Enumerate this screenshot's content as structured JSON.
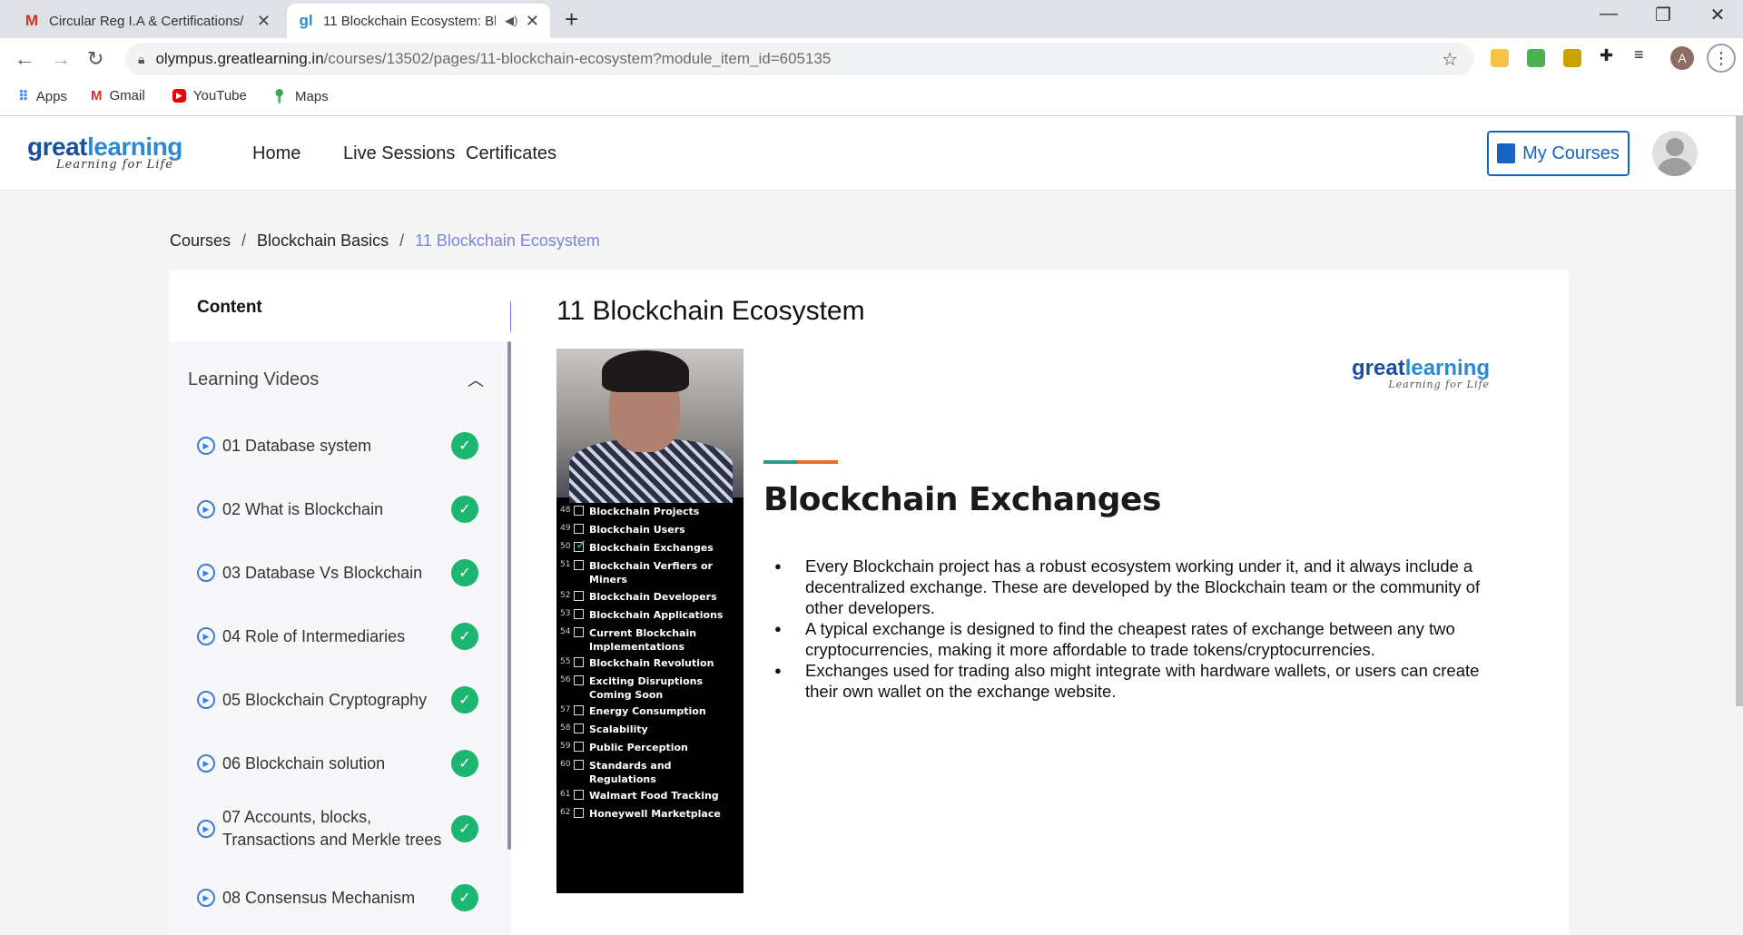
{
  "browser": {
    "tabs": [
      {
        "title": "Circular Reg I.A & Certifications/",
        "icon": "gmail-icon"
      },
      {
        "title": "11 Blockchain Ecosystem: Bl",
        "icon": "greatlearning-icon",
        "active": true
      }
    ],
    "url_host": "olympus.greatlearning.in",
    "url_path": "/courses/13502/pages/11-blockchain-ecosystem?module_item_id=605135",
    "profile_initial": "A",
    "bookmarks": [
      {
        "label": "Apps",
        "icon": "apps-grid-icon"
      },
      {
        "label": "Gmail",
        "icon": "gmail-icon"
      },
      {
        "label": "YouTube",
        "icon": "youtube-icon"
      },
      {
        "label": "Maps",
        "icon": "maps-icon"
      }
    ]
  },
  "site": {
    "logo": {
      "great": "great",
      "learning": "learning",
      "tagline": "Learning for Life"
    },
    "nav": [
      "Home",
      "Live Sessions",
      "Certificates"
    ],
    "my_courses": "My Courses",
    "colors": {
      "brand_blue": "#1565c0",
      "accent_purple": "#6c7ae0",
      "complete_green": "#1cb670"
    }
  },
  "breadcrumb": {
    "items": [
      "Courses",
      "Blockchain Basics"
    ],
    "separator": "/",
    "current": "11 Blockchain Ecosystem"
  },
  "sidebar": {
    "title": "Content",
    "section": "Learning Videos",
    "items": [
      {
        "label": "01 Database system"
      },
      {
        "label": "02 What is Blockchain"
      },
      {
        "label": "03 Database Vs Blockchain"
      },
      {
        "label": "04 Role of Intermediaries"
      },
      {
        "label": "05 Blockchain Cryptography"
      },
      {
        "label": "06 Blockchain solution"
      },
      {
        "label": "07 Accounts, blocks, Transactions and Merkle trees"
      },
      {
        "label": "08 Consensus Mechanism"
      }
    ]
  },
  "main": {
    "title": "11 Blockchain Ecosystem",
    "video_list": [
      {
        "n": "48",
        "label": "Blockchain Projects"
      },
      {
        "n": "49",
        "label": "Blockchain Users"
      },
      {
        "n": "50",
        "label": "Blockchain Exchanges",
        "checked": true
      },
      {
        "n": "51",
        "label": "Blockchain Verfiers or Miners"
      },
      {
        "n": "52",
        "label": "Blockchain Developers"
      },
      {
        "n": "53",
        "label": "Blockchain Applications"
      },
      {
        "n": "54",
        "label": "Current Blockchain Implementations"
      },
      {
        "n": "55",
        "label": "Blockchain Revolution"
      },
      {
        "n": "56",
        "label": "Exciting Disruptions Coming Soon"
      },
      {
        "n": "57",
        "label": "Energy Consumption"
      },
      {
        "n": "58",
        "label": "Scalability"
      },
      {
        "n": "59",
        "label": "Public Perception"
      },
      {
        "n": "60",
        "label": "Standards and Regulations"
      },
      {
        "n": "61",
        "label": "Walmart Food Tracking"
      },
      {
        "n": "62",
        "label": "Honeywell Marketplace"
      }
    ],
    "slide": {
      "logo_great": "great",
      "logo_learning": "learning",
      "logo_tagline": "Learning for Life",
      "heading": "Blockchain Exchanges",
      "bullets": [
        "Every Blockchain project has a robust ecosystem working under it, and it always include a decentralized exchange. These are developed by the Blockchain team or the community of other developers.",
        "A typical exchange is designed to find the cheapest rates of exchange between any two cryptocurrencies, making it more affordable to trade tokens/cryptocurrencies.",
        "Exchanges used for trading also might integrate with hardware wallets, or users can create their own wallet on the exchange website."
      ]
    }
  }
}
